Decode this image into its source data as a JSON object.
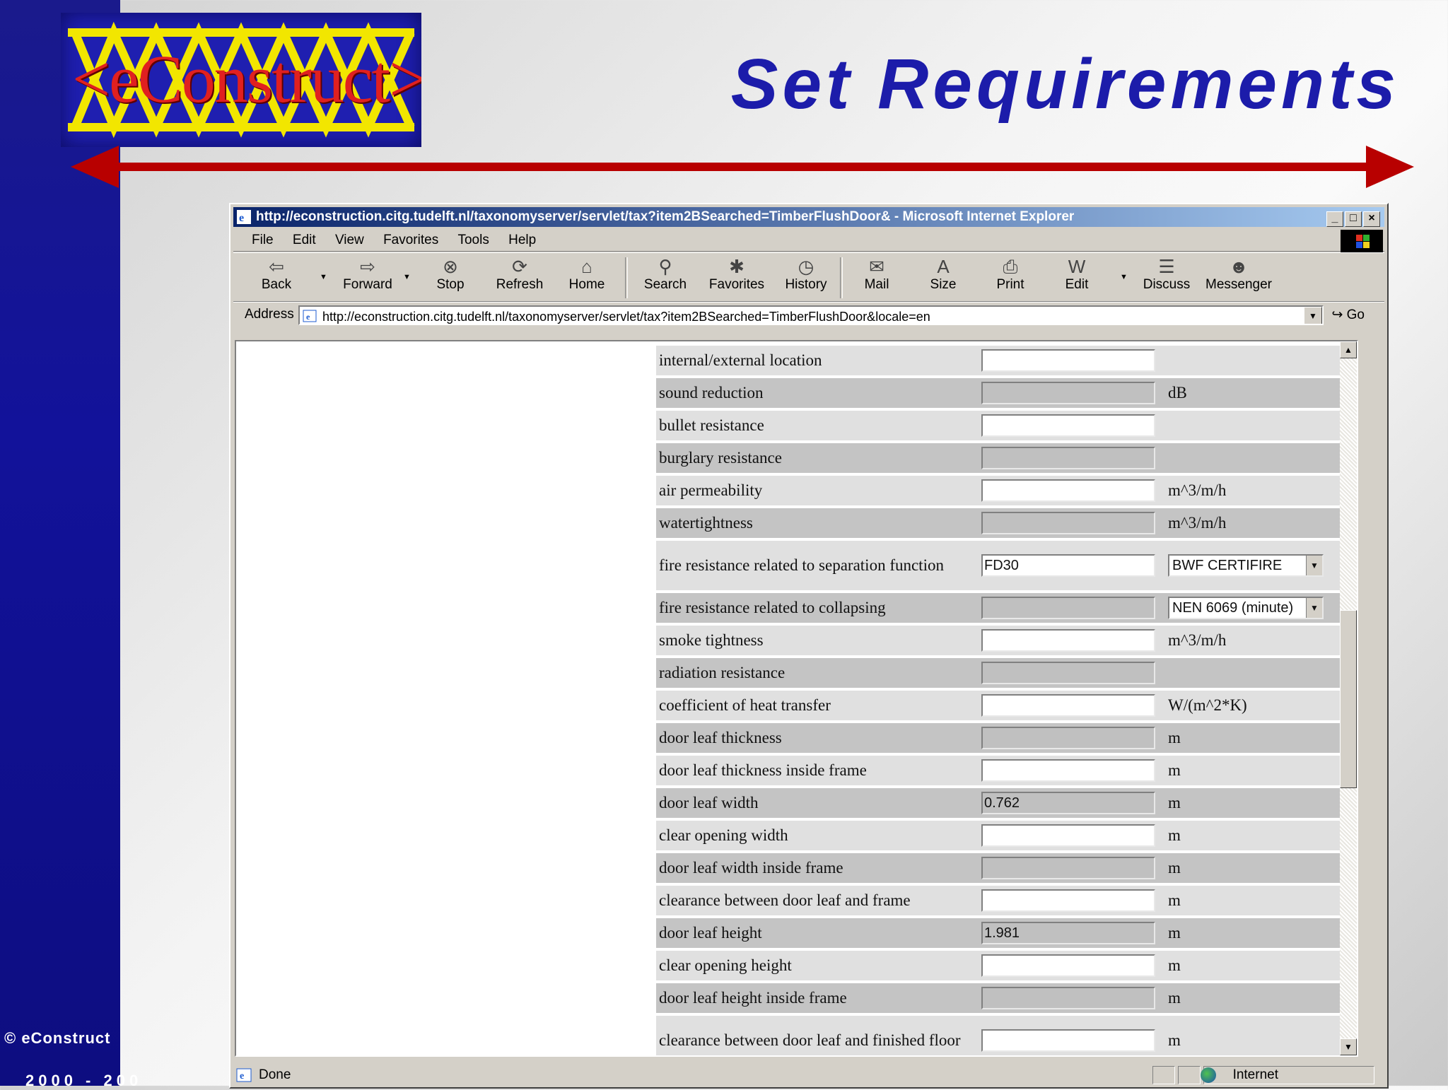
{
  "slide": {
    "title": "Set Requirements",
    "logo_text": "<eConstruct>",
    "footer": "© eConstruct",
    "footer_partial": "2000 - 200"
  },
  "browser": {
    "window_title": "http://econstruction.citg.tudelft.nl/taxonomyserver/servlet/tax?item2BSearched=TimberFlushDoor& - Microsoft Internet Explorer",
    "menu": [
      "File",
      "Edit",
      "View",
      "Favorites",
      "Tools",
      "Help"
    ],
    "toolbar": {
      "back": "Back",
      "forward": "Forward",
      "stop": "Stop",
      "refresh": "Refresh",
      "home": "Home",
      "search": "Search",
      "favorites": "Favorites",
      "history": "History",
      "mail": "Mail",
      "size": "Size",
      "print": "Print",
      "edit": "Edit",
      "discuss": "Discuss",
      "messenger": "Messenger"
    },
    "address_label": "Address",
    "address_value": "http://econstruction.citg.tudelft.nl/taxonomyserver/servlet/tax?item2BSearched=TimberFlushDoor&locale=en",
    "go_label": "Go",
    "status": "Done",
    "zone": "Internet"
  },
  "requirements": [
    {
      "label": "internal/external location",
      "value": "",
      "unit": ""
    },
    {
      "label": "sound reduction",
      "value": "",
      "unit": "dB"
    },
    {
      "label": "bullet resistance",
      "value": "",
      "unit": ""
    },
    {
      "label": "burglary resistance",
      "value": "",
      "unit": ""
    },
    {
      "label": "air permeability",
      "value": "",
      "unit": "m^3/m/h"
    },
    {
      "label": "watertightness",
      "value": "",
      "unit": "m^3/m/h"
    },
    {
      "label": "fire resistance related to separation function",
      "value": "FD30",
      "select": "BWF CERTIFIRE"
    },
    {
      "label": "fire resistance related to collapsing",
      "value": "",
      "select": "NEN 6069 (minute)"
    },
    {
      "label": "smoke tightness",
      "value": "",
      "unit": "m^3/m/h"
    },
    {
      "label": "radiation resistance",
      "value": "",
      "unit": ""
    },
    {
      "label": "coefficient of heat transfer",
      "value": "",
      "unit": "W/(m^2*K)"
    },
    {
      "label": "door leaf thickness",
      "value": "",
      "unit": "m"
    },
    {
      "label": "door leaf thickness inside frame",
      "value": "",
      "unit": "m"
    },
    {
      "label": "door leaf width",
      "value": "0.762",
      "unit": "m"
    },
    {
      "label": "clear opening width",
      "value": "",
      "unit": "m"
    },
    {
      "label": "door leaf width inside frame",
      "value": "",
      "unit": "m"
    },
    {
      "label": "clearance between door leaf and frame",
      "value": "",
      "unit": "m"
    },
    {
      "label": "door leaf height",
      "value": "1.981",
      "unit": "m"
    },
    {
      "label": "clear opening height",
      "value": "",
      "unit": "m"
    },
    {
      "label": "door leaf height inside frame",
      "value": "",
      "unit": "m"
    },
    {
      "label": "clearance between door leaf and finished floor",
      "value": "",
      "unit": "m"
    }
  ]
}
